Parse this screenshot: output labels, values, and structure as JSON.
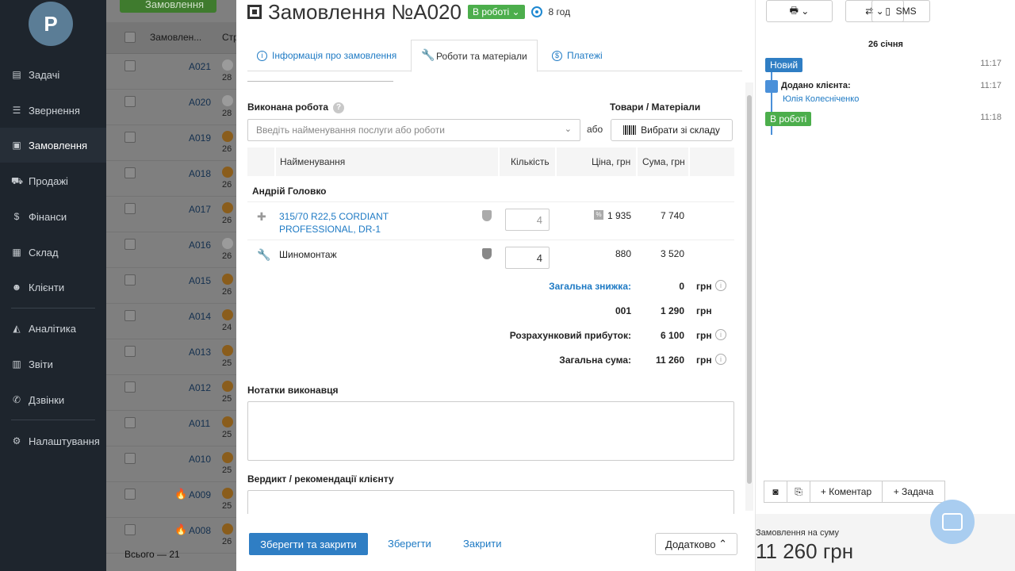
{
  "sidebar": {
    "logo": "P",
    "items": [
      {
        "label": "Задачі",
        "icon": "clipboard-icon"
      },
      {
        "label": "Звернення",
        "icon": "filter-icon"
      },
      {
        "label": "Замовлення",
        "icon": "orders-icon"
      },
      {
        "label": "Продажі",
        "icon": "cart-icon"
      },
      {
        "label": "Фінанси",
        "icon": "dollar-icon"
      },
      {
        "label": "Склад",
        "icon": "boxes-icon"
      },
      {
        "label": "Клієнти",
        "icon": "users-icon"
      },
      {
        "label": "Аналітика",
        "icon": "chart-icon"
      },
      {
        "label": "Звіти",
        "icon": "table-icon"
      },
      {
        "label": "Дзвінки",
        "icon": "phone-icon"
      },
      {
        "label": "Налаштування",
        "icon": "gear-icon"
      }
    ]
  },
  "orders_list": {
    "add_button": "Замовлення",
    "col_order": "Замовлен...",
    "col_status": "Стр",
    "rows": [
      {
        "num": "A021",
        "date": "28"
      },
      {
        "num": "A020",
        "date": "28"
      },
      {
        "num": "A019",
        "date": "26"
      },
      {
        "num": "A018",
        "date": "26"
      },
      {
        "num": "A017",
        "date": "26"
      },
      {
        "num": "A016",
        "date": "26"
      },
      {
        "num": "A015",
        "date": "26"
      },
      {
        "num": "A014",
        "date": "24"
      },
      {
        "num": "A013",
        "date": "25"
      },
      {
        "num": "A012",
        "date": "25"
      },
      {
        "num": "A011",
        "date": "25"
      },
      {
        "num": "A010",
        "date": "25"
      },
      {
        "num": "A009",
        "date": "25"
      },
      {
        "num": "A008",
        "date": "26"
      }
    ],
    "total": "Всього — 21"
  },
  "modal": {
    "title": "Замовлення №A020",
    "status": "В роботі",
    "timer": "8 год",
    "tabs": [
      {
        "label": "Інформація про замовлення"
      },
      {
        "label": "Роботи та матеріали"
      },
      {
        "label": "Платежі"
      }
    ],
    "work_label": "Виконана робота",
    "goods_label": "Товари / Матеріали",
    "work_placeholder": "Введіть найменування послуги або роботи",
    "or_text": "або",
    "stock_button": "Вибрати зі складу",
    "table": {
      "headers": {
        "name": "Найменування",
        "qty": "Кількість",
        "price": "Ціна, грн",
        "sum": "Сума, грн"
      },
      "group": "Андрій Головко",
      "items": [
        {
          "name": "315/70 R22,5 CORDIANT PROFESSIONAL, DR-1",
          "qty": "4",
          "price": "1 935",
          "sum": "7 740"
        },
        {
          "name": "Шиномонтаж",
          "qty": "4",
          "price": "880",
          "sum": "3 520"
        }
      ]
    },
    "totals": {
      "discount_label": "Загальна знижка:",
      "discount_value": "0",
      "row2_label": "001",
      "row2_value": "1 290",
      "profit_label": "Розрахунковий прибуток:",
      "profit_value": "6 100",
      "total_label": "Загальна сума:",
      "total_value": "11 260",
      "currency": "грн",
      "info": "i"
    },
    "notes_label": "Нотатки виконавця",
    "verdict_label": "Вердикт / рекомендації клієнту",
    "footer": {
      "save_close": "Зберегти та закрити",
      "save": "Зберегти",
      "close": "Закрити",
      "more": "Додатково"
    }
  },
  "right_panel": {
    "sms": "SMS",
    "date": "26 січня",
    "events": [
      {
        "badge": "Новий",
        "time": "11:17"
      },
      {
        "text": "Додано клієнта:",
        "link": "Юлія Колесніченко",
        "time": "11:17"
      },
      {
        "badge": "В роботі",
        "time": "11:18"
      }
    ],
    "comment_btn": "+ Коментар",
    "task_btn": "+ Задача",
    "sum_label": "Замовлення на суму",
    "sum_value": "11 260 грн"
  }
}
